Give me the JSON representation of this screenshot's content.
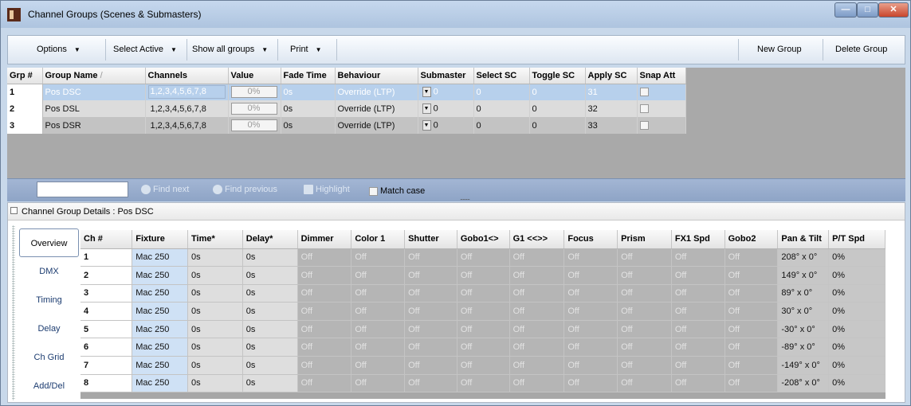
{
  "window": {
    "title": "Channel Groups (Scenes & Submasters)",
    "min": "—",
    "max": "□",
    "close": "✕"
  },
  "toolbar": {
    "options": "Options",
    "select_active": "Select Active",
    "show_all": "Show all groups",
    "print": "Print",
    "new_group": "New Group",
    "delete_group": "Delete Group",
    "dropdown_glyph": "▼"
  },
  "groups": {
    "columns": [
      "Grp #",
      "Group Name",
      "Channels",
      "Value",
      "Fade Time",
      "Behaviour",
      "Submaster",
      "Select SC",
      "Toggle SC",
      "Apply SC",
      "Snap Att"
    ],
    "sort_indicator": "/",
    "rows": [
      {
        "grp": "1",
        "name": "Pos DSC",
        "channels": "1,2,3,4,5,6,7,8",
        "value": "0%",
        "fade": "0s",
        "behaviour": "Override (LTP)",
        "submaster": "0",
        "select_sc": "0",
        "toggle_sc": "0",
        "apply_sc": "31"
      },
      {
        "grp": "2",
        "name": "Pos DSL",
        "channels": "1,2,3,4,5,6,7,8",
        "value": "0%",
        "fade": "0s",
        "behaviour": "Override (LTP)",
        "submaster": "0",
        "select_sc": "0",
        "toggle_sc": "0",
        "apply_sc": "32"
      },
      {
        "grp": "3",
        "name": "Pos DSR",
        "channels": "1,2,3,4,5,6,7,8",
        "value": "0%",
        "fade": "0s",
        "behaviour": "Override (LTP)",
        "submaster": "0",
        "select_sc": "0",
        "toggle_sc": "0",
        "apply_sc": "33"
      }
    ]
  },
  "find": {
    "input_value": "",
    "find_next": "Find next",
    "find_previous": "Find previous",
    "highlight": "Highlight",
    "match_case": "Match case"
  },
  "details": {
    "title": "Channel Group Details : Pos DSC",
    "tabs": [
      "Overview",
      "DMX",
      "Timing",
      "Delay",
      "Ch Grid",
      "Add/Del"
    ],
    "columns": [
      "Ch #",
      "Fixture",
      "Time*",
      "Delay*",
      "Dimmer",
      "Color 1",
      "Shutter",
      "Gobo1<>",
      "G1 <<>>",
      "Focus",
      "Prism",
      "FX1 Spd",
      "Gobo2",
      "Pan & Tilt",
      "P/T Spd"
    ],
    "off_text": "Off",
    "rows": [
      {
        "ch": "1",
        "fixture": "Mac 250",
        "time": "0s",
        "delay": "0s",
        "pan_tilt": "208° x 0°",
        "pt_spd": "0%"
      },
      {
        "ch": "2",
        "fixture": "Mac 250",
        "time": "0s",
        "delay": "0s",
        "pan_tilt": "149° x 0°",
        "pt_spd": "0%"
      },
      {
        "ch": "3",
        "fixture": "Mac 250",
        "time": "0s",
        "delay": "0s",
        "pan_tilt": "89° x 0°",
        "pt_spd": "0%"
      },
      {
        "ch": "4",
        "fixture": "Mac 250",
        "time": "0s",
        "delay": "0s",
        "pan_tilt": "30° x 0°",
        "pt_spd": "0%"
      },
      {
        "ch": "5",
        "fixture": "Mac 250",
        "time": "0s",
        "delay": "0s",
        "pan_tilt": "-30° x 0°",
        "pt_spd": "0%"
      },
      {
        "ch": "6",
        "fixture": "Mac 250",
        "time": "0s",
        "delay": "0s",
        "pan_tilt": "-89° x 0°",
        "pt_spd": "0%"
      },
      {
        "ch": "7",
        "fixture": "Mac 250",
        "time": "0s",
        "delay": "0s",
        "pan_tilt": "-149° x 0°",
        "pt_spd": "0%"
      },
      {
        "ch": "8",
        "fixture": "Mac 250",
        "time": "0s",
        "delay": "0s",
        "pan_tilt": "-208° x 0°",
        "pt_spd": "0%"
      }
    ]
  }
}
